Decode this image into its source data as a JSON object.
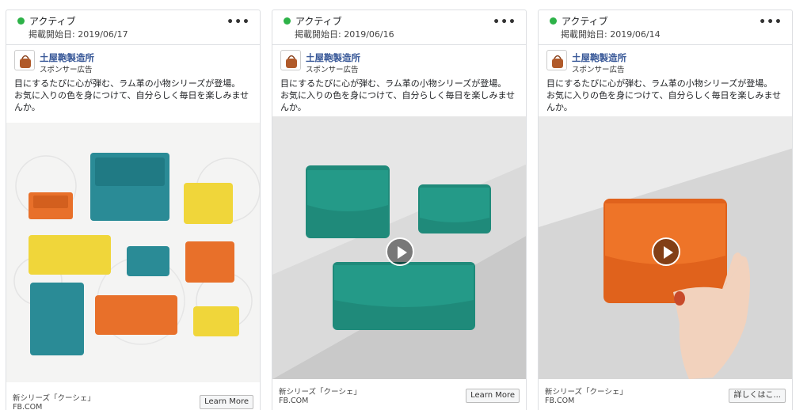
{
  "cards": [
    {
      "status": "アクティブ",
      "start_date": "掲載開始日: 2019/06/17",
      "more": "•••",
      "page_name": "土屋鞄製造所",
      "sponsored": "スポンサー広告",
      "body_line1": "目にするたびに心が弾む、ラム革の小物シリーズが登場。",
      "body_line2": "お気に入りの色を身につけて、自分らしく毎日を楽しみませんか。",
      "caption": "新シリーズ「クーシェ」",
      "domain": "FB.COM",
      "cta": "Learn More"
    },
    {
      "status": "アクティブ",
      "start_date": "掲載開始日: 2019/06/16",
      "more": "•••",
      "page_name": "土屋鞄製造所",
      "sponsored": "スポンサー広告",
      "body_line1": "目にするたびに心が弾む、ラム革の小物シリーズが登場。",
      "body_line2": "お気に入りの色を身につけて、自分らしく毎日を楽しみませんか。",
      "caption": "新シリーズ「クーシェ」",
      "domain": "FB.COM",
      "cta": "Learn More"
    },
    {
      "status": "アクティブ",
      "start_date": "掲載開始日: 2019/06/14",
      "more": "•••",
      "page_name": "土屋鞄製造所",
      "sponsored": "スポンサー広告",
      "body_line1": "目にするたびに心が弾む、ラム革の小物シリーズが登場。",
      "body_line2": "お気に入りの色を身につけて、自分らしく毎日を楽しみませんか。",
      "caption": "新シリーズ「クーシェ」",
      "domain": "FB.COM",
      "cta": "詳しくはこ..."
    }
  ],
  "colors": {
    "active_dot": "#2db248",
    "link": "#385898",
    "teal": "#1f8a7a",
    "orange": "#e8702a",
    "yellow": "#f0d63a",
    "blue_teal": "#2a8b96"
  },
  "icons": {
    "status": "active-dot-icon",
    "more": "more-options-icon",
    "avatar": "bag-logo-icon",
    "play": "play-icon"
  }
}
